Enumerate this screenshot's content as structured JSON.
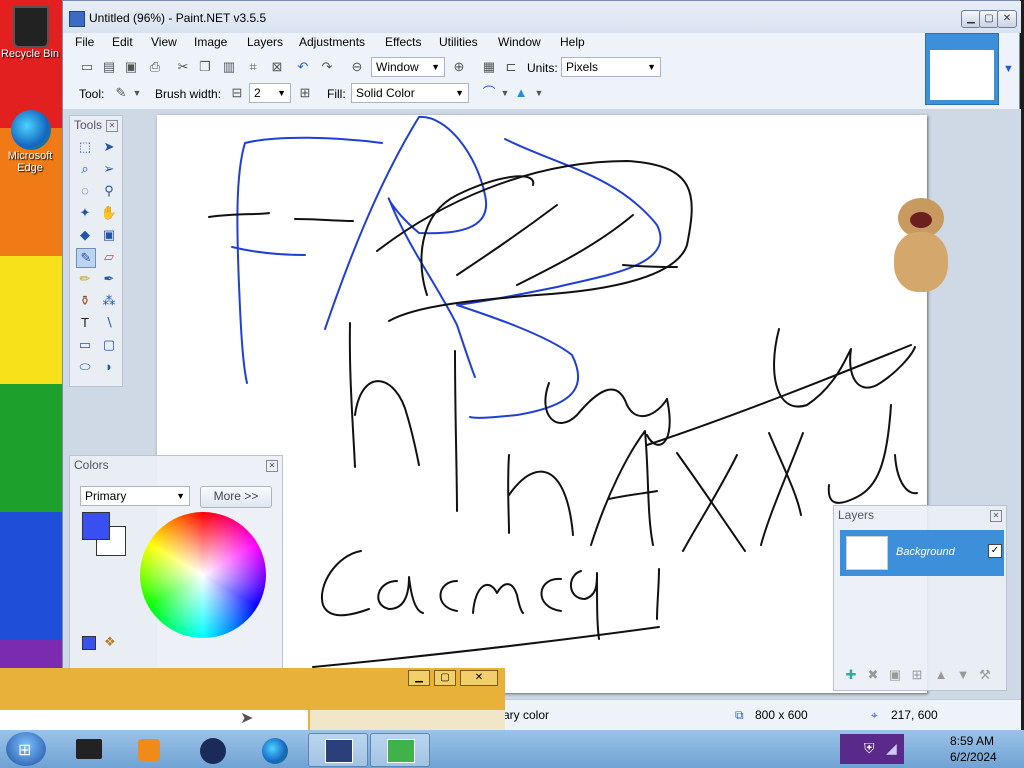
{
  "desktop": {
    "stripe_colors": [
      "#e32020",
      "#f07a16",
      "#f7e11a",
      "#1ea12c",
      "#1f4fd8",
      "#7b2bb0"
    ],
    "icons": [
      {
        "label": "Recycle Bin",
        "icon": "recycle-bin-icon"
      },
      {
        "label": "Microsoft Edge",
        "icon": "edge-icon"
      }
    ]
  },
  "window": {
    "title": "Untitled (96%) - Paint.NET v3.5.5",
    "controls": [
      "minimize",
      "maximize",
      "close"
    ]
  },
  "menu": [
    "File",
    "Edit",
    "View",
    "Image",
    "Layers",
    "Adjustments",
    "Effects",
    "Utilities",
    "Window",
    "Help"
  ],
  "toolbar1": {
    "zoom_value": "Window",
    "units_label": "Units:",
    "units_value": "Pixels"
  },
  "toolbar2": {
    "tool_label": "Tool:",
    "brush_width_label": "Brush width:",
    "brush_width_value": "2",
    "fill_label": "Fill:",
    "fill_value": "Solid Color"
  },
  "tools_panel": {
    "title": "Tools"
  },
  "colors_panel": {
    "title": "Colors",
    "mode": "Primary",
    "more_button": "More >>",
    "primary_color": "#3a4ff0",
    "secondary_color": "#ffffff"
  },
  "layers_panel": {
    "title": "Layers",
    "layer_name": "Background",
    "layer_checked": true
  },
  "status": {
    "hint": "ary color",
    "size": "800 x 600",
    "cursor": "217, 600"
  },
  "taskbar": {
    "time": "8:59 AM",
    "date": "6/2/2024"
  },
  "drawing": {
    "ink_blue": "#1f3fd6",
    "ink_black": "#111111"
  }
}
